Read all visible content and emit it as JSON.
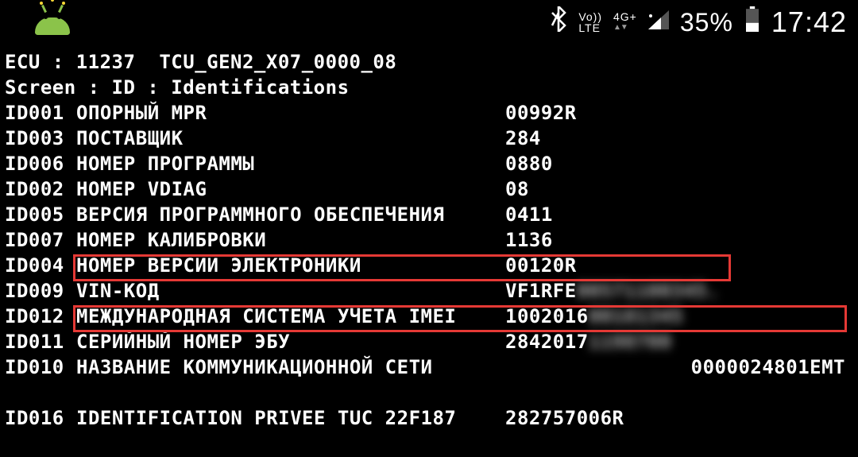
{
  "statusbar": {
    "volte_top": "Vo))",
    "volte_bot": "LTE",
    "net_top": "4G+",
    "battery_pct": "35%",
    "time": "17:42"
  },
  "header": {
    "ecu_line": "ECU : 11237  TCU_GEN2_X07_0000_08",
    "screen_line": "Screen : ID : Identifications"
  },
  "rows": [
    {
      "id": "ID001",
      "label": "ОПОРНЫЙ MPR",
      "value": "00992R"
    },
    {
      "id": "ID003",
      "label": "ПОСТАВЩИК",
      "value": "284"
    },
    {
      "id": "ID006",
      "label": "НОМЕР ПРОГРАММЫ",
      "value": "0880"
    },
    {
      "id": "ID002",
      "label": "НОМЕР VDIAG",
      "value": "08"
    },
    {
      "id": "ID005",
      "label": "ВЕРСИЯ ПРОГРАММНОГО ОБЕСПЕЧЕНИЯ",
      "value": "0411"
    },
    {
      "id": "ID007",
      "label": "НОМЕР КАЛИБРОВКИ",
      "value": "1136"
    },
    {
      "id": "ID004",
      "label": "НОМЕР ВЕРСИИ ЭЛЕКТРОНИКИ",
      "value": "00120R"
    },
    {
      "id": "ID009",
      "label": "VIN-КОД",
      "value": "VF1RFE",
      "blur": "00571100345."
    },
    {
      "id": "ID012",
      "label": "МЕЖДУНАРОДНАЯ СИСТЕМА УЧЕТА IMEI",
      "value": "1002016",
      "blur": "00181345"
    },
    {
      "id": "ID011",
      "label": "СЕРИЙНЫЙ НОМЕР ЭБУ",
      "value": "2842017",
      "blur": "1198700"
    },
    {
      "id": "ID010",
      "label": "НАЗВАНИЕ КОММУНИКАЦИОННОЙ СЕТИ",
      "value_right": "0000024801EMT"
    }
  ],
  "row_extra": {
    "id": "ID016",
    "label": "IDENTIFICATION PRIVEE TUC 22F187",
    "value": "282757006R"
  }
}
